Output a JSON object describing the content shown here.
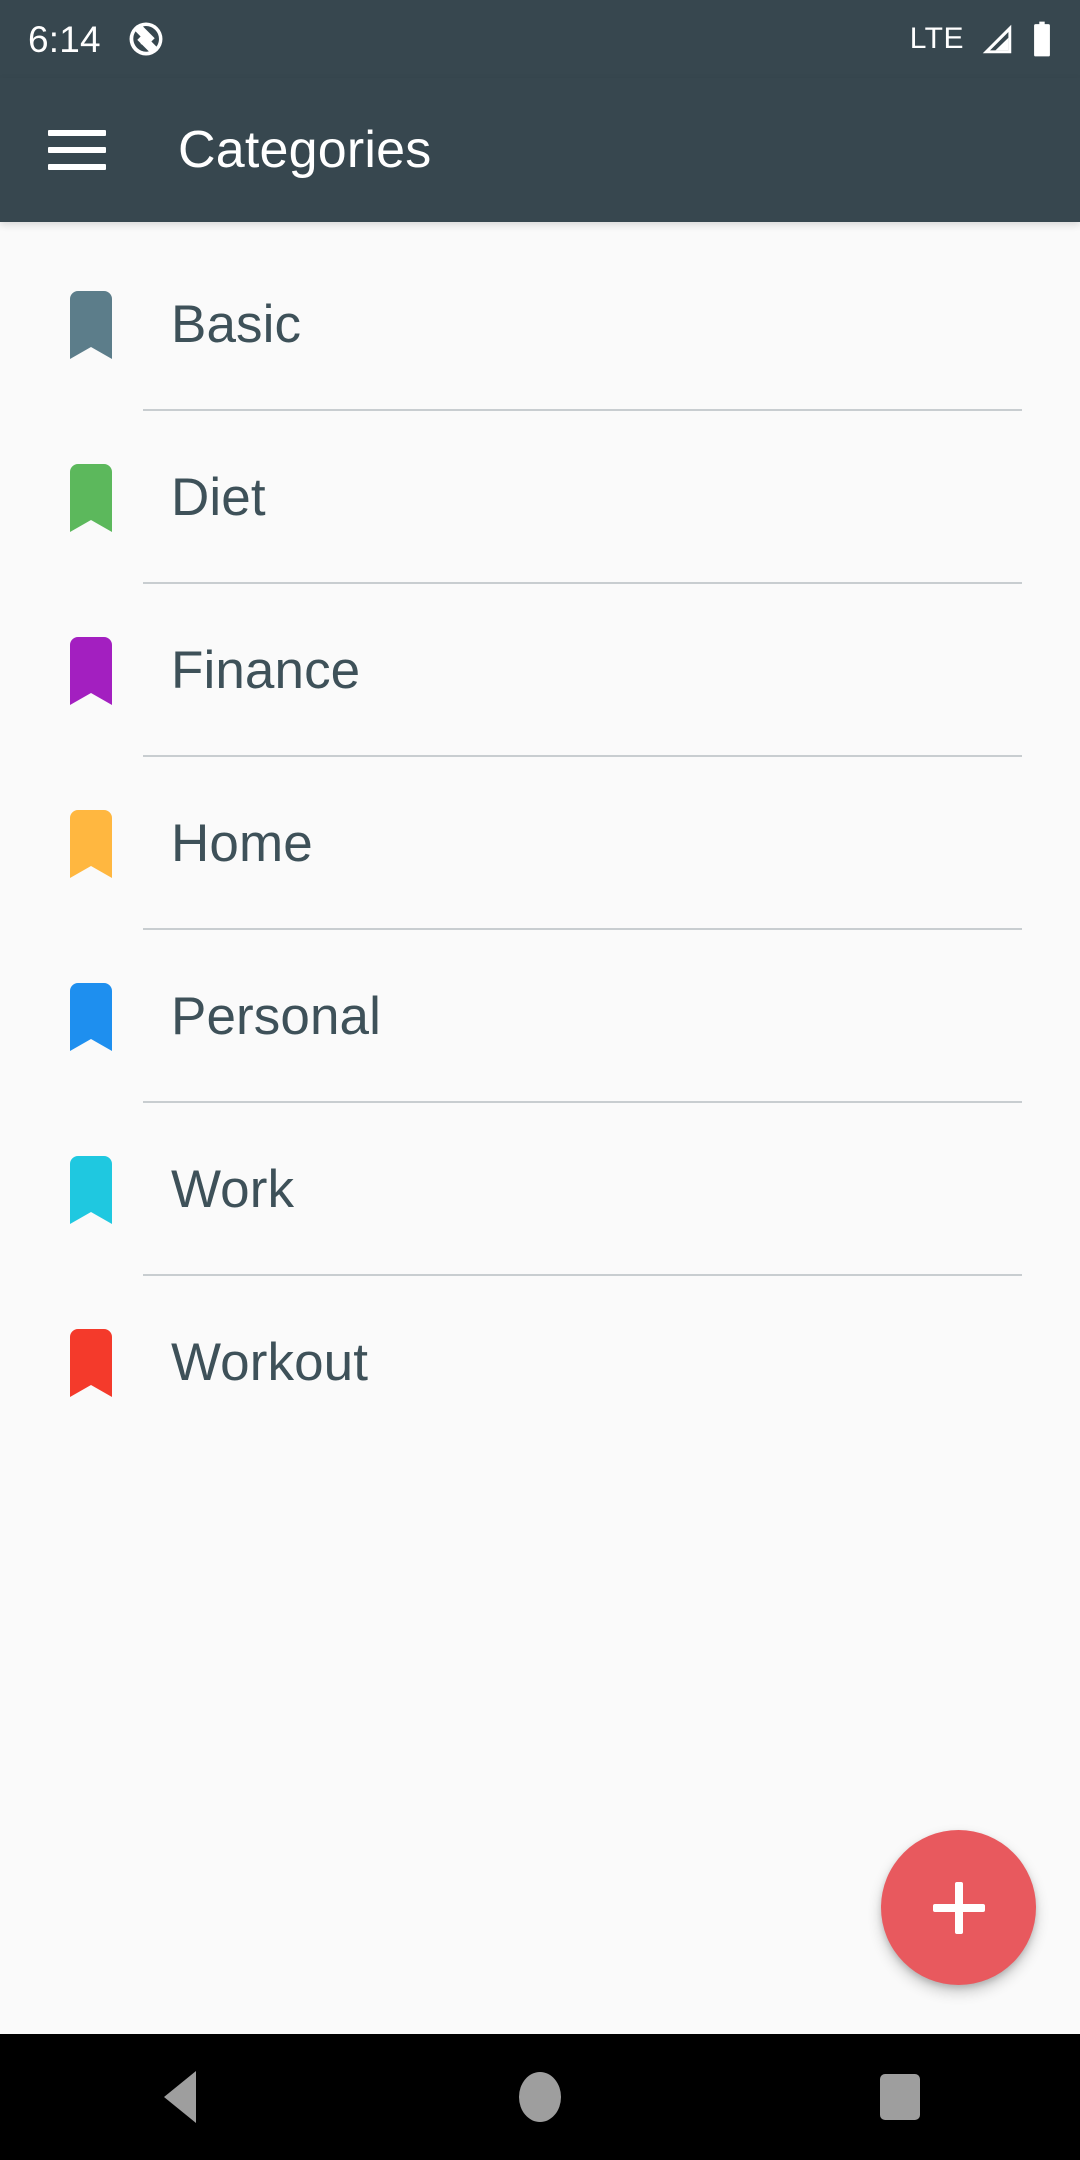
{
  "status_bar": {
    "time": "6:14",
    "left_icon": "circle-slash-icon",
    "network_label": "LTE",
    "signal_icon": "signal-bars-icon",
    "battery_icon": "battery-full-icon",
    "background_color": "#37474f",
    "text_color": "#ffffff"
  },
  "app_bar": {
    "menu_icon": "hamburger-menu-icon",
    "title": "Categories",
    "background_color": "#37474f",
    "title_color": "#ffffff"
  },
  "list": {
    "items": [
      {
        "label": "Basic",
        "color": "#5c7d8a",
        "icon": "bookmark-icon"
      },
      {
        "label": "Diet",
        "color": "#5cb85c",
        "icon": "bookmark-icon"
      },
      {
        "label": "Finance",
        "color": "#a31fc0",
        "icon": "bookmark-icon"
      },
      {
        "label": "Home",
        "color": "#ffb740",
        "icon": "bookmark-icon"
      },
      {
        "label": "Personal",
        "color": "#1e8fef",
        "icon": "bookmark-icon"
      },
      {
        "label": "Work",
        "color": "#1fc8e0",
        "icon": "bookmark-icon"
      },
      {
        "label": "Workout",
        "color": "#f43a2b",
        "icon": "bookmark-icon"
      }
    ],
    "label_color": "#3e5159",
    "divider_color": "#c8cdd0",
    "background_color": "#fafafa"
  },
  "fab": {
    "icon": "plus-icon",
    "label": "+",
    "color": "#e8595e"
  },
  "nav_bar": {
    "background_color": "#000000",
    "icon_color": "#9e9e9e",
    "buttons": [
      {
        "name": "back-button",
        "icon": "triangle-back-icon"
      },
      {
        "name": "home-button",
        "icon": "circle-home-icon"
      },
      {
        "name": "recents-button",
        "icon": "square-recents-icon"
      }
    ]
  }
}
